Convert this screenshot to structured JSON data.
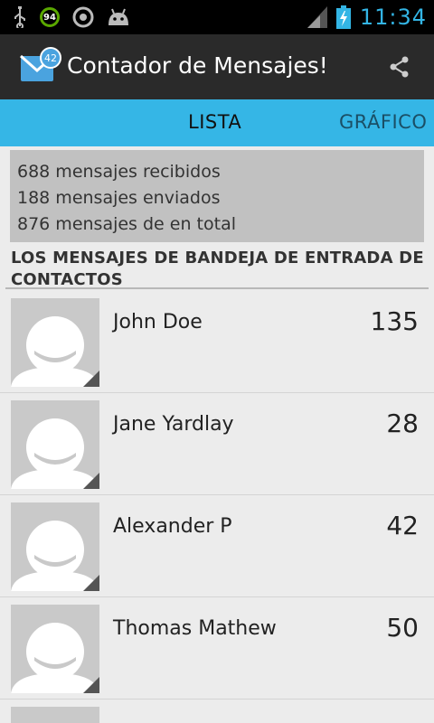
{
  "status_bar": {
    "time": "11:34",
    "battery_ring_value": "94",
    "icons": [
      "usb-icon",
      "battery-ring-icon",
      "app-circle-icon",
      "android-icon",
      "signal-icon",
      "battery-icon"
    ]
  },
  "action_bar": {
    "title": "Contador de Mensajes!",
    "app_icon_badge": "42",
    "share_icon": "share-icon"
  },
  "tabs": [
    {
      "label": "LISTA",
      "selected": true
    },
    {
      "label": "GRÁFICO",
      "selected": false
    }
  ],
  "summary": {
    "received": "688 mensajes recibidos",
    "sent": "188 mensajes enviados",
    "total": "876 mensajes de en total"
  },
  "section_title": "LOS MENSAJES DE BANDEJA DE ENTRADA DE CONTACTOS",
  "contacts": [
    {
      "name": "John Doe",
      "count": "135"
    },
    {
      "name": "Jane Yardlay",
      "count": "28"
    },
    {
      "name": "Alexander P",
      "count": "42"
    },
    {
      "name": "Thomas Mathew",
      "count": "50"
    }
  ],
  "colors": {
    "accent": "#35b6e6",
    "status_time": "#33b5e5",
    "action_bar": "#2a2a2a",
    "summary_bg": "#c1c1c1"
  }
}
